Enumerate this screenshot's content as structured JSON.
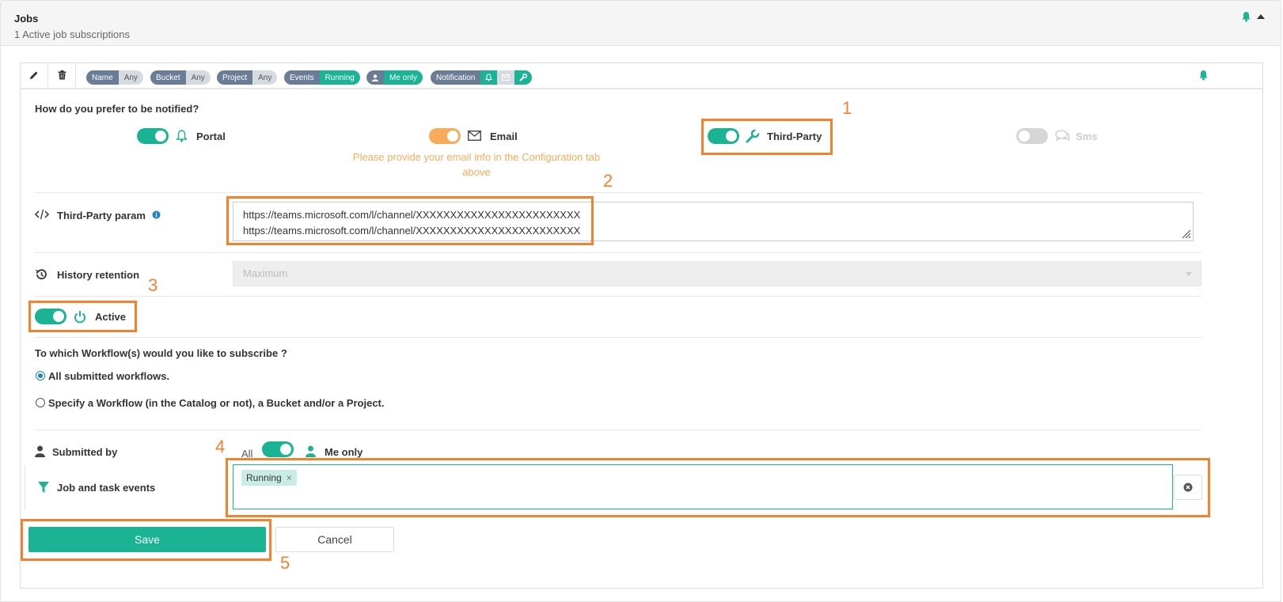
{
  "header": {
    "title": "Jobs",
    "subtitle": "1 Active job subscriptions"
  },
  "toolbar": {
    "tags": [
      {
        "key": "Name",
        "value": "Any"
      },
      {
        "key": "Bucket",
        "value": "Any"
      },
      {
        "key": "Project",
        "value": "Any"
      },
      {
        "key": "Events",
        "value": "Running"
      },
      {
        "key": "",
        "value": "Me only"
      },
      {
        "key": "Notification",
        "value": ""
      }
    ]
  },
  "notify": {
    "question": "How do you prefer to be notified?",
    "portal": "Portal",
    "email": "Email",
    "email_warning_line1": "Please provide your email info in the Configuration tab",
    "email_warning_line2": "above",
    "third_party": "Third-Party",
    "sms": "Sms"
  },
  "third_party_param": {
    "label": "Third-Party param",
    "value": "https://teams.microsoft.com/l/channel/XXXXXXXXXXXXXXXXXXXXXXXX\nhttps://teams.microsoft.com/l/channel/XXXXXXXXXXXXXXXXXXXXXXXX"
  },
  "history": {
    "label": "History retention",
    "value": "Maximum"
  },
  "active": {
    "label": "Active"
  },
  "workflows": {
    "question": "To which Workflow(s) would you like to subscribe ?",
    "option_all": "All submitted workflows.",
    "option_specify": "Specify a Workflow (in the Catalog or not), a Bucket and/or a Project."
  },
  "submitted_by": {
    "label": "Submitted by",
    "all": "All",
    "me_only": "Me only"
  },
  "events": {
    "label": "Job and task events",
    "chip": "Running",
    "chip_remove": "×"
  },
  "buttons": {
    "save": "Save",
    "cancel": "Cancel"
  },
  "annotations": [
    "1",
    "2",
    "3",
    "4",
    "5"
  ],
  "colors": {
    "accent": "#1ab394",
    "warning": "#f8ac59",
    "annotation": "#f5812d",
    "tag_key": "#6b7d96"
  }
}
